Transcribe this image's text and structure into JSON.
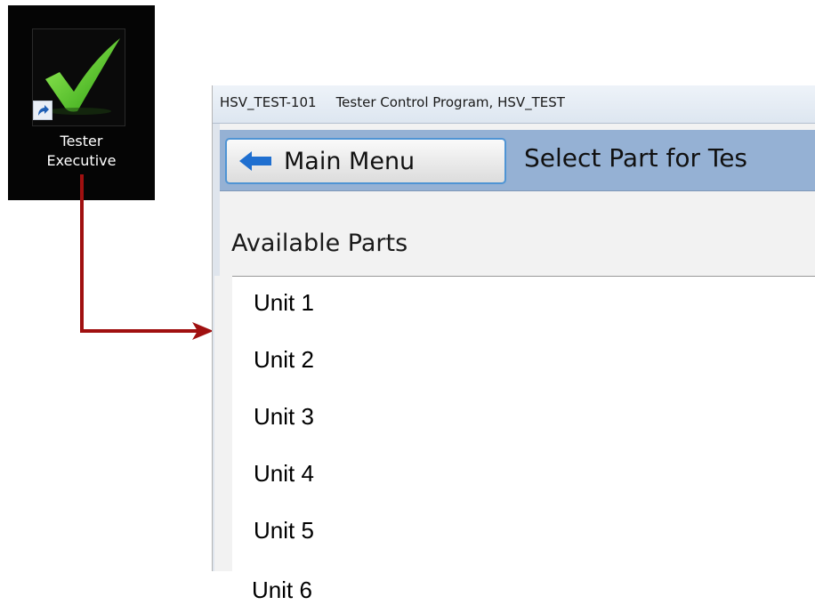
{
  "desktop_shortcut": {
    "label_line1": "Tester",
    "label_line2": "Executive",
    "icon": "checkmark-icon",
    "badge_icon": "shortcut-arrow-icon"
  },
  "window": {
    "title_id": "HSV_TEST-101",
    "title_text": "Tester Control Program, HSV_TEST"
  },
  "toolbar": {
    "back_label": "Main Menu",
    "back_icon": "left-arrow-icon",
    "page_title": "Select Part for Tes"
  },
  "parts": {
    "heading": "Available Parts",
    "items": [
      "Unit 1",
      "Unit 2",
      "Unit 3",
      "Unit 4",
      "Unit 5",
      "Unit 6"
    ]
  },
  "colors": {
    "toolbar_bg": "#95b1d4",
    "button_border": "#4f94d4",
    "connector": "#a01010",
    "checkmark": "#4fcf1f"
  }
}
